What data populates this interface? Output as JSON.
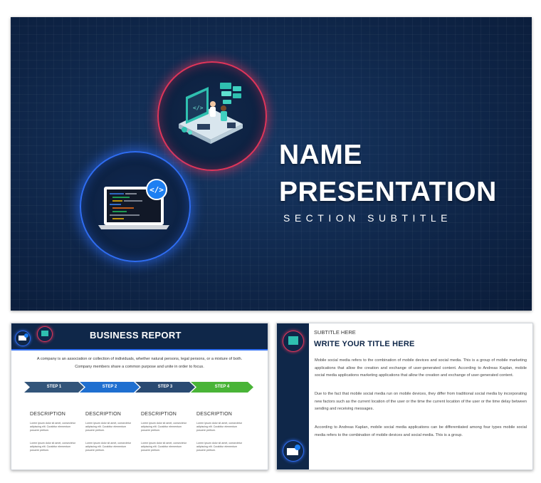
{
  "main_slide": {
    "title_line1": "NAME",
    "title_line2": "PRESENTATION",
    "subtitle": "SECTION SUBTITLE",
    "icons": [
      "developers-workstation-icon",
      "laptop-code-icon"
    ],
    "colors": {
      "background": "#0f2749",
      "ring_red": "#e0355a",
      "ring_blue": "#2f6df2"
    }
  },
  "business_report": {
    "title": "BUSINESS REPORT",
    "intro_line1": "A company is an association or collection of individuals, whether natural persons, legal persons, or a mixture of both.",
    "intro_line2": "Company members share a common purpose and unite in order to focus.",
    "steps": [
      {
        "label": "STEP 1",
        "color": "#33557a"
      },
      {
        "label": "STEP 2",
        "color": "#1f6fd0"
      },
      {
        "label": "STEP 3",
        "color": "#2a4a72"
      },
      {
        "label": "STEP 4",
        "color": "#49b437"
      }
    ],
    "columns": [
      {
        "heading": "DESCRIPTION",
        "text1": "Lorem ipsum dolor sit amet, consectetur adipiscing elit. Curabitur elementum posuere pretium.",
        "text2": "Lorem ipsum dolor sit amet, consectetur adipiscing elit. Curabitur elementum posuere pretium."
      },
      {
        "heading": "DESCRIPTION",
        "text1": "Lorem ipsum dolor sit amet, consectetur adipiscing elit. Curabitur elementum posuere pretium.",
        "text2": "Lorem ipsum dolor sit amet, consectetur adipiscing elit. Curabitur elementum posuere pretium."
      },
      {
        "heading": "DESCRIPTION",
        "text1": "Lorem ipsum dolor sit amet, consectetur adipiscing elit. Curabitur elementum posuere pretium.",
        "text2": "Lorem ipsum dolor sit amet, consectetur adipiscing elit. Curabitur elementum posuere pretium."
      },
      {
        "heading": "DESCRIPTION",
        "text1": "Lorem ipsum dolor sit amet, consectetur adipiscing elit. Curabitur elementum posuere pretium.",
        "text2": "Lorem ipsum dolor sit amet, consectetur adipiscing elit. Curabitur elementum posuere pretium."
      }
    ]
  },
  "article_slide": {
    "subtitle": "SUBTITLE HERE",
    "title": "WRITE YOUR TITLE HERE",
    "paragraphs": [
      "Mobile social media refers to the combination of mobile devices and social media. This is a group of mobile marketing applications that allow the creation and exchange of user-generated content. According to Andreas Kaplan, mobile social media applications marketing applications that allow the creation and exchange of user-generated content.",
      "Due to the fact that mobile social media run on mobile devices, they differ from traditional social media by incorporating new factors such as the current location of the user or the time the current location of the user or the time delay between sending and receiving messages.",
      "According to Andreas Kaplan, mobile social media applications can be differentiated among four types mobile social media refers to the combination of mobile devices and social media. This is a group."
    ]
  }
}
